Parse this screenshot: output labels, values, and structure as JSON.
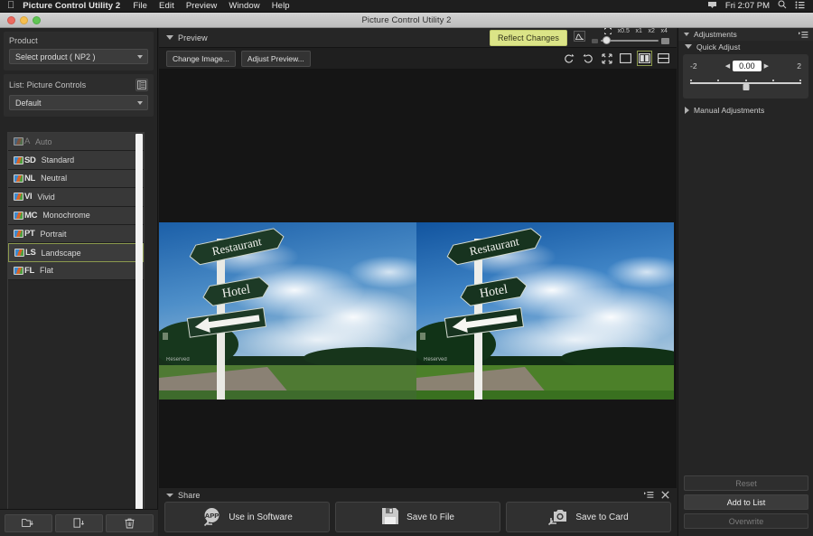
{
  "menubar": {
    "apple_icon": "apple-icon",
    "app_name": "Picture Control Utility 2",
    "items": [
      "File",
      "Edit",
      "Preview",
      "Window",
      "Help"
    ],
    "clock": "Fri 2:07 PM",
    "right_icons": [
      "airplay-icon",
      "search-icon",
      "control-center-icon"
    ]
  },
  "window": {
    "title": "Picture Control Utility 2"
  },
  "left": {
    "product_label": "Product",
    "product_value": "Select product ( NP2 )",
    "list_label": "List: Picture Controls",
    "list_icon": "list-view-icon",
    "filter_value": "Default",
    "controls": [
      {
        "abbr": "A",
        "label": "Auto",
        "selected": false,
        "dim": true
      },
      {
        "abbr": "SD",
        "label": "Standard",
        "selected": false,
        "dim": false
      },
      {
        "abbr": "NL",
        "label": "Neutral",
        "selected": false,
        "dim": false
      },
      {
        "abbr": "VI",
        "label": "Vivid",
        "selected": false,
        "dim": false
      },
      {
        "abbr": "MC",
        "label": "Monochrome",
        "selected": false,
        "dim": false
      },
      {
        "abbr": "PT",
        "label": "Portrait",
        "selected": false,
        "dim": false
      },
      {
        "abbr": "LS",
        "label": "Landscape",
        "selected": true,
        "dim": false
      },
      {
        "abbr": "FL",
        "label": "Flat",
        "selected": false,
        "dim": false
      }
    ],
    "toolbar_icons": [
      "folder-import-icon",
      "file-export-icon",
      "trash-icon"
    ]
  },
  "preview": {
    "section_title": "Preview",
    "reflect_changes_label": "Reflect Changes",
    "histogram_icon": "histogram-icon",
    "zoom_fit_icon": "fit-to-window-icon",
    "zoom_marks": [
      "x0.5",
      "x1",
      "x2",
      "x4"
    ],
    "change_image_label": "Change Image...",
    "adjust_preview_label": "Adjust Preview...",
    "view_icons": [
      "rotate-left-icon",
      "rotate-right-icon",
      "fullscreen-icon",
      "single-view-icon",
      "side-by-side-view-icon",
      "split-view-icon"
    ],
    "active_view_icon": "side-by-side-view-icon",
    "image_signs": {
      "top": "Restaurant",
      "middle": "Hotel",
      "arrow": "left-arrow-sign"
    }
  },
  "share": {
    "section_title": "Share",
    "menu_icon": "list-menu-icon",
    "close_icon": "close-icon",
    "buttons": [
      {
        "label": "Use in Software",
        "icon": "app-export-icon"
      },
      {
        "label": "Save to File",
        "icon": "floppy-disk-icon"
      },
      {
        "label": "Save to Card",
        "icon": "camera-export-icon"
      }
    ]
  },
  "adjustments": {
    "section_title": "Adjustments",
    "menu_icon": "list-menu-icon",
    "quick_adjust_title": "Quick Adjust",
    "min_label": "-2",
    "max_label": "2",
    "value": "0.00",
    "left_arrow": "◀",
    "right_arrow": "▶",
    "manual_title": "Manual Adjustments",
    "buttons": [
      {
        "label": "Reset",
        "state": "dimmed"
      },
      {
        "label": "Add to List",
        "state": "primary"
      },
      {
        "label": "Overwrite",
        "state": "dimmed"
      }
    ]
  },
  "colors": {
    "accent_yellow": "#dbe487",
    "selection_outline": "#8c9a4e",
    "panel_bg": "#252525"
  }
}
